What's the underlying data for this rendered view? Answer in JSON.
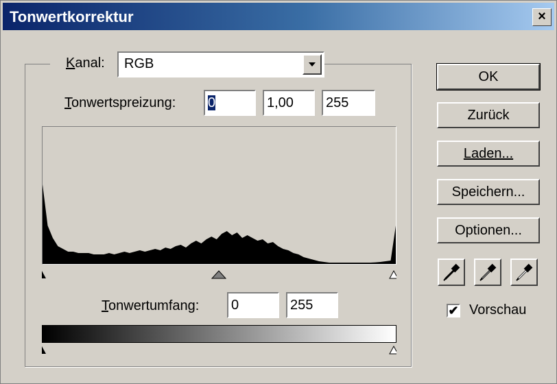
{
  "window": {
    "title": "Tonwertkorrektur",
    "close_label": "×"
  },
  "channel": {
    "label": "Kanal:",
    "value": "RGB"
  },
  "input_levels": {
    "label": "Tonwertspreizung:",
    "black": "0",
    "gamma": "1,00",
    "white": "255"
  },
  "output_levels": {
    "label": "Tonwertumfang:",
    "black": "0",
    "white": "255"
  },
  "buttons": {
    "ok": "OK",
    "reset": "Zurück",
    "load": "Laden...",
    "save": "Speichern...",
    "options": "Optionen..."
  },
  "preview": {
    "label": "Vorschau",
    "checked": true,
    "check_mark": "✔"
  },
  "eyedroppers": [
    "black-eyedropper-icon",
    "gray-eyedropper-icon",
    "white-eyedropper-icon"
  ],
  "histogram": [
    0.58,
    0.28,
    0.19,
    0.13,
    0.11,
    0.09,
    0.09,
    0.08,
    0.08,
    0.08,
    0.07,
    0.07,
    0.07,
    0.08,
    0.07,
    0.08,
    0.09,
    0.08,
    0.09,
    0.1,
    0.09,
    0.1,
    0.11,
    0.1,
    0.12,
    0.11,
    0.13,
    0.14,
    0.12,
    0.15,
    0.17,
    0.15,
    0.18,
    0.2,
    0.18,
    0.22,
    0.24,
    0.21,
    0.23,
    0.19,
    0.21,
    0.19,
    0.17,
    0.18,
    0.15,
    0.16,
    0.13,
    0.11,
    0.1,
    0.08,
    0.07,
    0.05,
    0.04,
    0.03,
    0.02,
    0.015,
    0.01,
    0.01,
    0.01,
    0.01,
    0.01,
    0.01,
    0.01,
    0.01,
    0.01,
    0.012,
    0.015,
    0.02,
    0.025,
    0.28
  ]
}
